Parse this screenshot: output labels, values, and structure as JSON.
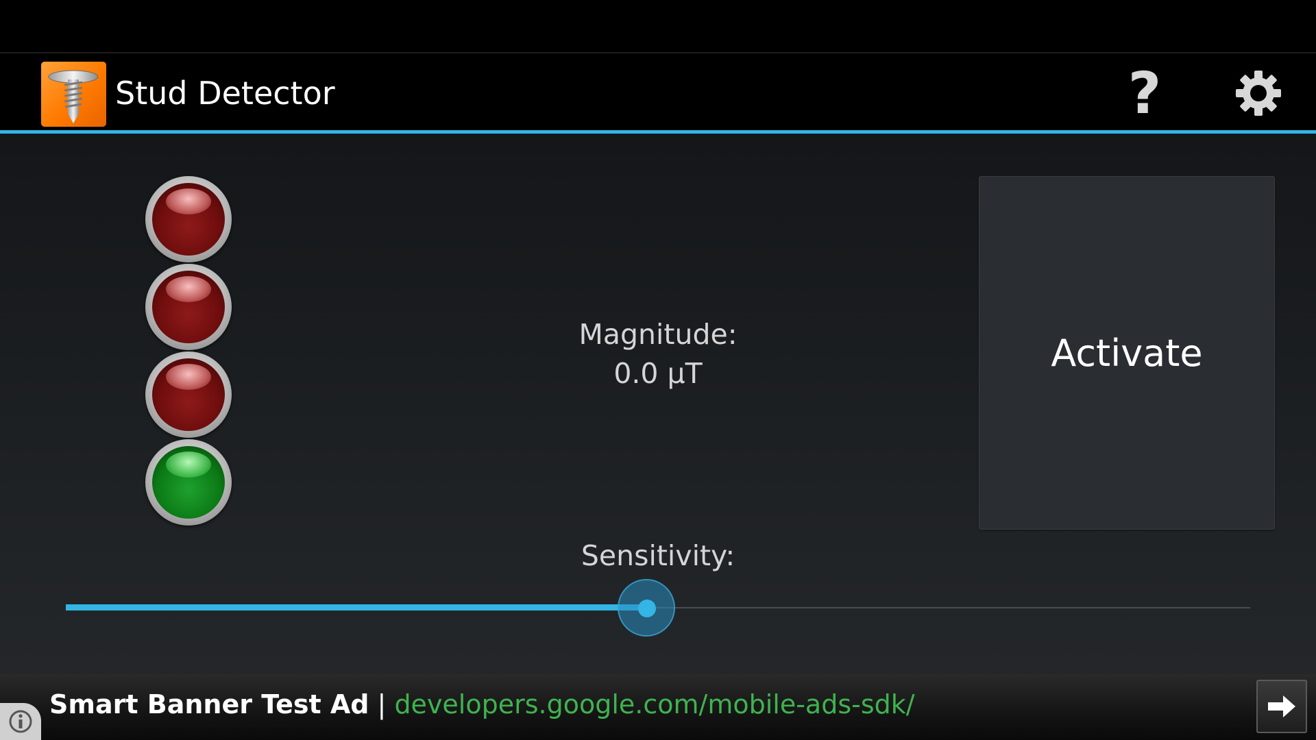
{
  "app": {
    "title": "Stud Detector"
  },
  "toolbar": {
    "help_label": "?",
    "settings_icon": "gear-icon"
  },
  "indicators": {
    "leds": [
      {
        "state": "off",
        "color": "red"
      },
      {
        "state": "off",
        "color": "red"
      },
      {
        "state": "off",
        "color": "red"
      },
      {
        "state": "on",
        "color": "green"
      }
    ]
  },
  "readout": {
    "magnitude_label": "Magnitude:",
    "magnitude_value": "0.0 μT"
  },
  "activate": {
    "label": "Activate"
  },
  "sensitivity": {
    "label": "Sensitivity:",
    "value": 0.49
  },
  "ad": {
    "title": "Smart Banner Test Ad",
    "separator": " | ",
    "url": "developers.google.com/mobile-ads-sdk/"
  },
  "colors": {
    "accent": "#33b5e5",
    "logo": "#ff8a1c",
    "ad_url": "#3fb34f"
  }
}
